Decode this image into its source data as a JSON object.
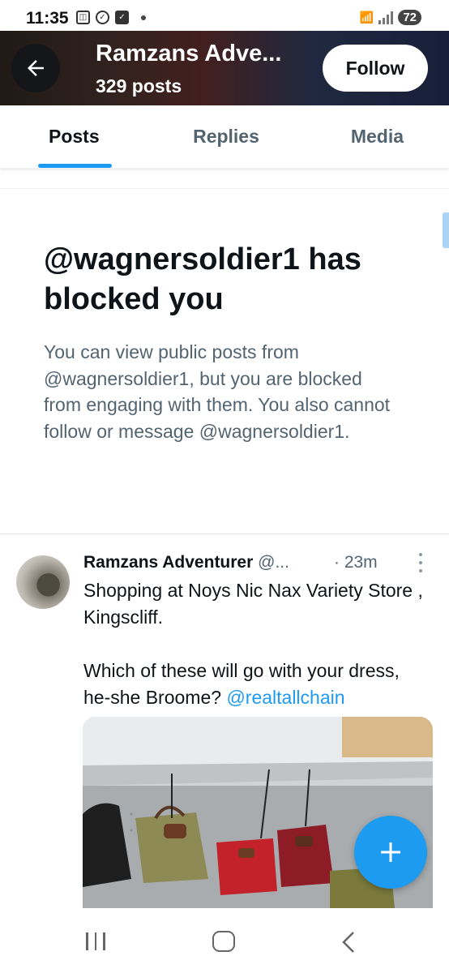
{
  "status_bar": {
    "time": "11:35",
    "battery": "72",
    "wifi_label": "5"
  },
  "header": {
    "title": "Ramzans Adve...",
    "subtitle": "329 posts",
    "follow_label": "Follow"
  },
  "tabs": [
    {
      "label": "Posts",
      "active": true
    },
    {
      "label": "Replies",
      "active": false
    },
    {
      "label": "Media",
      "active": false
    }
  ],
  "blocked": {
    "title": "@wagnersoldier1 has blocked you",
    "body": "You can view public posts from @wagnersoldier1, but you are blocked from engaging with them. You also cannot follow or message @wagnersoldier1."
  },
  "post": {
    "name": "Ramzans Adventurer",
    "handle": "@...",
    "time": "· 23m",
    "text_line1": "Shopping at Noys Nic Nax Variety Store , Kingscliff.",
    "text_line2": "Which of these will go with your dress, he-she Broome? ",
    "mention": "@realtallchain"
  },
  "colors": {
    "accent": "#1d9bf0",
    "text_primary": "#0f1419",
    "text_secondary": "#536471"
  },
  "icons": {
    "back": "arrow-left-icon",
    "more": "more-vertical-icon",
    "compose": "plus-icon"
  }
}
